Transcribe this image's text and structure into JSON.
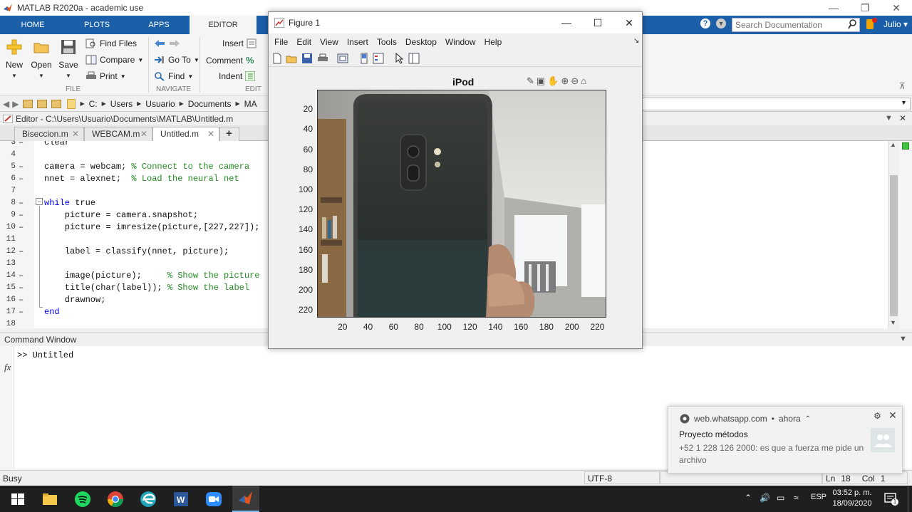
{
  "window": {
    "title": "MATLAB R2020a - academic use"
  },
  "ribbon": {
    "tabs": [
      "HOME",
      "PLOTS",
      "APPS",
      "EDITOR"
    ],
    "search_placeholder": "Search Documentation",
    "user": "Julio",
    "file": {
      "new": "New",
      "open": "Open",
      "save": "Save",
      "find_files": "Find Files",
      "compare": "Compare",
      "print": "Print",
      "group": "FILE"
    },
    "navigate": {
      "go_to": "Go To",
      "find": "Find",
      "group": "NAVIGATE"
    },
    "edit": {
      "insert": "Insert",
      "comment": "Comment",
      "indent": "Indent",
      "group": "EDIT"
    }
  },
  "address": {
    "crumbs": [
      "C:",
      "Users",
      "Usuario",
      "Documents",
      "MA"
    ]
  },
  "editor": {
    "header": "Editor - C:\\Users\\Usuario\\Documents\\MATLAB\\Untitled.m",
    "tabs": [
      "Biseccion.m",
      "WEBCAM.m",
      "Untitled.m"
    ],
    "lines": [
      {
        "n": "3",
        "dash": "–",
        "code": "clear",
        "comment": ""
      },
      {
        "n": "4",
        "dash": "",
        "code": "",
        "comment": ""
      },
      {
        "n": "5",
        "dash": "–",
        "code": "camera = webcam; ",
        "comment": "% Connect to the camera"
      },
      {
        "n": "6",
        "dash": "–",
        "code": "nnet = alexnet;  ",
        "comment": "% Load the neural net"
      },
      {
        "n": "7",
        "dash": "",
        "code": "",
        "comment": ""
      },
      {
        "n": "8",
        "dash": "–",
        "kw": "while",
        "code": " true",
        "comment": ""
      },
      {
        "n": "9",
        "dash": "–",
        "code": "    picture = camera.snapshot;",
        "comment": ""
      },
      {
        "n": "10",
        "dash": "–",
        "code": "    picture = imresize(picture,[227,227]);",
        "comment": ""
      },
      {
        "n": "11",
        "dash": "",
        "code": "",
        "comment": ""
      },
      {
        "n": "12",
        "dash": "–",
        "code": "    label = classify(nnet, picture);",
        "comment": ""
      },
      {
        "n": "13",
        "dash": "",
        "code": "",
        "comment": ""
      },
      {
        "n": "14",
        "dash": "–",
        "code": "    image(picture);     ",
        "comment": "% Show the picture"
      },
      {
        "n": "15",
        "dash": "–",
        "code": "    title(char(label)); ",
        "comment": "% Show the label"
      },
      {
        "n": "16",
        "dash": "–",
        "code": "    drawnow;",
        "comment": ""
      },
      {
        "n": "17",
        "dash": "–",
        "kw": "end",
        "code": "",
        "comment": ""
      },
      {
        "n": "18",
        "dash": "",
        "code": "",
        "comment": ""
      }
    ]
  },
  "command_window": {
    "header": "Command Window",
    "prompt": ">> Untitled",
    "fx": "fx"
  },
  "status": {
    "left": "Busy",
    "encoding": "UTF-8",
    "ln_label": "Ln",
    "ln": "18",
    "col_label": "Col",
    "col": "1"
  },
  "figure": {
    "title": "Figure 1",
    "menu": [
      "File",
      "Edit",
      "View",
      "Insert",
      "Tools",
      "Desktop",
      "Window",
      "Help"
    ],
    "plot_title": "iPod",
    "yticks": [
      "20",
      "40",
      "60",
      "80",
      "100",
      "120",
      "140",
      "160",
      "180",
      "200",
      "220"
    ],
    "xticks": [
      "20",
      "40",
      "60",
      "80",
      "100",
      "120",
      "140",
      "160",
      "180",
      "200",
      "220"
    ]
  },
  "toast": {
    "source": "web.whatsapp.com",
    "time": "ahora",
    "title": "Proyecto métodos",
    "message": "+52 1 228 126 2000: es que a fuerza me pide un archivo"
  },
  "taskbar": {
    "lang": "ESP",
    "time": "03:52 p. m.",
    "date": "18/09/2020",
    "notif_count": "1"
  }
}
